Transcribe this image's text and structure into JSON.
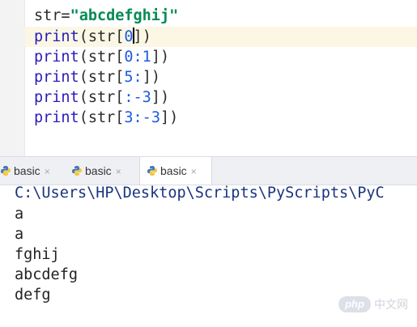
{
  "editor": {
    "lines": [
      {
        "var": "str",
        "eq": "=",
        "string": "\"abcdefghij\""
      },
      {
        "fn": "print",
        "open": "(",
        "arg": "str",
        "lb": "[",
        "before_caret": "0",
        "after_caret": "]",
        "close": ")"
      },
      {
        "fn": "print",
        "open": "(",
        "arg": "str",
        "lb": "[",
        "idx": "0:1",
        "rb": "]",
        "close": ")"
      },
      {
        "fn": "print",
        "open": "(",
        "arg": "str",
        "lb": "[",
        "idx": "5:",
        "rb": "]",
        "close": ")"
      },
      {
        "fn": "print",
        "open": "(",
        "arg": "str",
        "lb": "[",
        "idx": ":-3",
        "rb": "]",
        "close": ")"
      },
      {
        "fn": "print",
        "open": "(",
        "arg": "str",
        "lb": "[",
        "idx": "3:-3",
        "rb": "]",
        "close": ")"
      }
    ]
  },
  "tabs": [
    {
      "label": "basic",
      "close": "×",
      "icon": "python-icon"
    },
    {
      "label": "basic",
      "close": "×",
      "icon": "python-icon"
    },
    {
      "label": "basic",
      "close": "×",
      "icon": "python-icon",
      "active": true
    }
  ],
  "console": {
    "path": "C:\\Users\\HP\\Desktop\\Scripts\\PyScripts\\PyC",
    "outputs": [
      "a",
      "a",
      "fghij",
      "abcdefg",
      "defg"
    ]
  },
  "watermark": {
    "logo": "php",
    "text": "中文网"
  },
  "colors": {
    "current_line": "#fbf7e4",
    "string": "#068a54",
    "number": "#1b5be0",
    "function": "#2a1bb8",
    "tabbar": "#eef0f4"
  }
}
